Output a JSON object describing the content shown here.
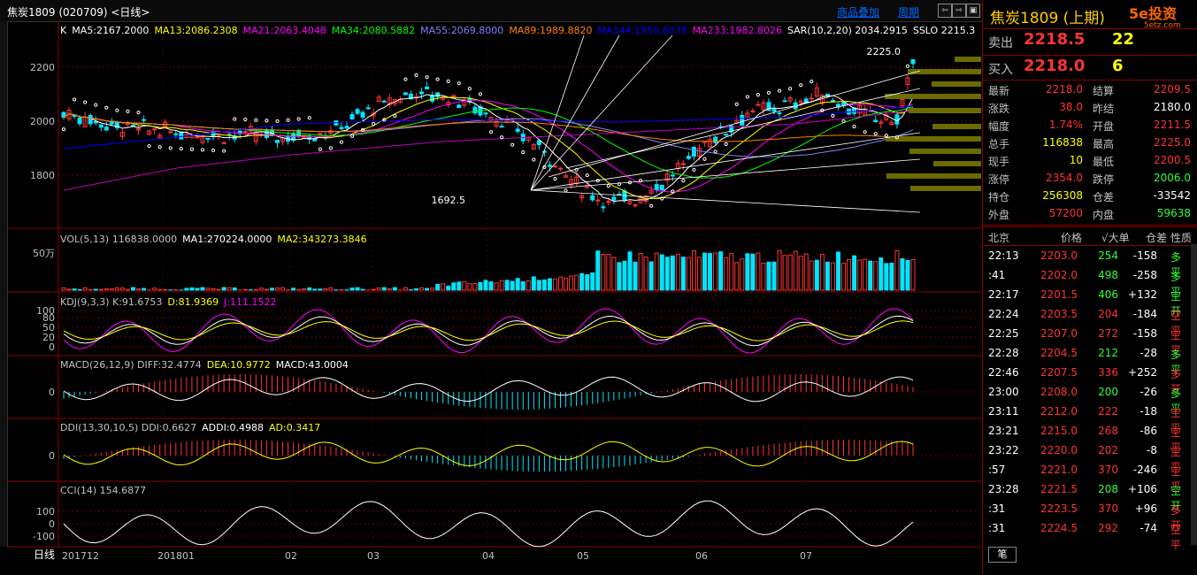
{
  "window": {
    "title": "焦炭1809 (020709) <日线>",
    "overlay_label": "商品叠加",
    "period_label": "周期",
    "nav_buttons": [
      "⇦",
      "⇨",
      "▣"
    ]
  },
  "chart": {
    "left_axis_labels": [
      "日线"
    ],
    "price_ticks": [
      "2200",
      "2000",
      "1800"
    ],
    "vol_ticks": [
      "50万"
    ],
    "kdj_ticks": [
      "100",
      "80",
      "50",
      "20",
      "0"
    ],
    "macd_ticks": [
      "0"
    ],
    "ddi_ticks": [
      "0"
    ],
    "cci_ticks": [
      "100",
      "0",
      "-100"
    ],
    "x_labels": [
      "201712",
      "201801",
      "02",
      "03",
      "04",
      "05",
      "06",
      "07"
    ],
    "high_label": "2225.0",
    "low_label": "1692.5",
    "main_legend": [
      {
        "text": "K",
        "color": "#ffffff"
      },
      {
        "text": "MA5:2167.2000",
        "color": "#ffffff"
      },
      {
        "text": "MA13:2086.2308",
        "color": "#ffff00"
      },
      {
        "text": "MA21:2063.4048",
        "color": "#ff00ff"
      },
      {
        "text": "MA34:2080.5882",
        "color": "#00ff00"
      },
      {
        "text": "MA55:2069.8000",
        "color": "#8080ff"
      },
      {
        "text": "MA89:1989.8820",
        "color": "#ff8000"
      },
      {
        "text": "MA144:1950.6078",
        "color": "#0000ff"
      },
      {
        "text": "MA233:1982.8026",
        "color": "#ff00ff"
      },
      {
        "text": "SAR(10,2,20) 2034.2915",
        "color": "#ffffff"
      },
      {
        "text": "SSLO 2215.3",
        "color": "#ffffff"
      }
    ],
    "vol_legend": [
      {
        "text": "VOL(5,13) 116838.0000",
        "color": "#c0c0c0"
      },
      {
        "text": "MA1:270224.0000",
        "color": "#ffffff"
      },
      {
        "text": "MA2:343273.3846",
        "color": "#ffff00"
      }
    ],
    "kdj_legend": [
      {
        "text": "KDJ(9,3,3) K:91.6753",
        "color": "#c0c0c0"
      },
      {
        "text": "D:81.9369",
        "color": "#ffff00"
      },
      {
        "text": "J:111.1522",
        "color": "#ff00ff"
      }
    ],
    "macd_legend": [
      {
        "text": "MACD(26,12,9) DIFF:32.4774",
        "color": "#c0c0c0"
      },
      {
        "text": "DEA:10.9772",
        "color": "#ffff00"
      },
      {
        "text": "MACD:43.0004",
        "color": "#ffffff"
      }
    ],
    "ddi_legend": [
      {
        "text": "DDI(13,30,10,5) DDI:0.6627",
        "color": "#c0c0c0"
      },
      {
        "text": "ADDI:0.4988",
        "color": "#ffffff"
      },
      {
        "text": "AD:0.3417",
        "color": "#ffff00"
      }
    ],
    "cci_legend": [
      {
        "text": "CCI(14) 154.6877",
        "color": "#c0c0c0"
      }
    ]
  },
  "quote": {
    "name": "焦炭1809 (上期)",
    "logo": "5e投资",
    "logo_sub": "5etz.com",
    "sell_label": "卖出",
    "sell_price": "2218.5",
    "sell_qty": "22",
    "buy_label": "买入",
    "buy_price": "2218.0",
    "buy_qty": "6",
    "fields": [
      {
        "l1": "最新",
        "v1": "2218.0",
        "c1": "red",
        "l2": "结算",
        "v2": "2209.5",
        "c2": "red"
      },
      {
        "l1": "涨跌",
        "v1": "38.0",
        "c1": "red",
        "l2": "昨结",
        "v2": "2180.0",
        "c2": "white"
      },
      {
        "l1": "幅度",
        "v1": "1.74%",
        "c1": "red",
        "l2": "开盘",
        "v2": "2211.5",
        "c2": "red"
      },
      {
        "l1": "总手",
        "v1": "116838",
        "c1": "yellow",
        "l2": "最高",
        "v2": "2225.0",
        "c2": "red"
      },
      {
        "l1": "现手",
        "v1": "10",
        "c1": "yellow",
        "l2": "最低",
        "v2": "2200.5",
        "c2": "red"
      },
      {
        "l1": "涨停",
        "v1": "2354.0",
        "c1": "red",
        "l2": "跌停",
        "v2": "2006.0",
        "c2": "green"
      },
      {
        "l1": "持仓",
        "v1": "256308",
        "c1": "yellow",
        "l2": "仓差",
        "v2": "-33542",
        "c2": "white"
      },
      {
        "l1": "外盘",
        "v1": "57200",
        "c1": "red",
        "l2": "内盘",
        "v2": "59638",
        "c2": "green"
      }
    ],
    "tick_headers": [
      "北京",
      "价格",
      "√大单",
      "仓差",
      "性质"
    ],
    "ticks": [
      {
        "time": "22:13",
        "price": "2203.0",
        "vol": "254",
        "vc": "green",
        "diff": "-158",
        "type": "多平",
        "tc": "green"
      },
      {
        "time": ":41",
        "price": "2202.0",
        "vol": "498",
        "vc": "green",
        "diff": "-258",
        "type": "多平",
        "tc": "green"
      },
      {
        "time": "22:17",
        "price": "2201.5",
        "vol": "406",
        "vc": "green",
        "diff": "+132",
        "type": "空开",
        "tc": "green"
      },
      {
        "time": "22:24",
        "price": "2203.5",
        "vol": "204",
        "vc": "red",
        "diff": "-184",
        "type": "空平",
        "tc": "red"
      },
      {
        "time": "22:25",
        "price": "2207.0",
        "vol": "272",
        "vc": "red",
        "diff": "-158",
        "type": "空平",
        "tc": "red"
      },
      {
        "time": "22:28",
        "price": "2204.5",
        "vol": "212",
        "vc": "green",
        "diff": "-28",
        "type": "多平",
        "tc": "green"
      },
      {
        "time": "22:46",
        "price": "2207.5",
        "vol": "336",
        "vc": "red",
        "diff": "+252",
        "type": "多开",
        "tc": "red"
      },
      {
        "time": "23:00",
        "price": "2208.0",
        "vol": "200",
        "vc": "green",
        "diff": "-26",
        "type": "多平",
        "tc": "green"
      },
      {
        "time": "23:11",
        "price": "2212.0",
        "vol": "222",
        "vc": "red",
        "diff": "-18",
        "type": "空平",
        "tc": "red"
      },
      {
        "time": "23:21",
        "price": "2215.0",
        "vol": "268",
        "vc": "red",
        "diff": "-86",
        "type": "空平",
        "tc": "red"
      },
      {
        "time": "23:22",
        "price": "2220.0",
        "vol": "202",
        "vc": "red",
        "diff": "-8",
        "type": "空平",
        "tc": "red"
      },
      {
        "time": ":57",
        "price": "2221.0",
        "vol": "370",
        "vc": "red",
        "diff": "-246",
        "type": "空平",
        "tc": "red"
      },
      {
        "time": "23:28",
        "price": "2221.5",
        "vol": "208",
        "vc": "green",
        "diff": "+106",
        "type": "空开",
        "tc": "green"
      },
      {
        "time": ":31",
        "price": "2223.5",
        "vol": "370",
        "vc": "red",
        "diff": "+96",
        "type": "多开",
        "tc": "red"
      },
      {
        "time": ":31",
        "price": "2224.5",
        "vol": "292",
        "vc": "red",
        "diff": "-74",
        "type": "空平",
        "tc": "red"
      }
    ],
    "bottom_tab": "笔"
  }
}
